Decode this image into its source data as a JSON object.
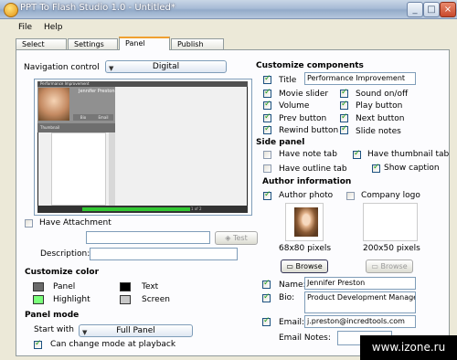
{
  "window": {
    "title": "PPT To Flash Studio 1.0 - Untitled*"
  },
  "caption_buttons": {
    "minimize": "_",
    "maximize": "□",
    "close": "×"
  },
  "menu": {
    "file": "File",
    "help": "Help"
  },
  "tabs": [
    "Select",
    "Settings",
    "Panel",
    "Publish"
  ],
  "left": {
    "nav_label": "Navigation control",
    "nav_value": "Digital",
    "preview": {
      "title": "Performance Improvement",
      "author": "Jennifer Preston",
      "bio_btn": "Bio",
      "email_btn": "Email",
      "thumbnail_label": "Thumbnail",
      "pages": "1 of 2"
    },
    "attachment_label": "Have Attachment",
    "test_label": "Test",
    "description_label": "Description:",
    "customize_color_header": "Customize color",
    "colors": {
      "panel": {
        "label": "Panel",
        "hex": "#6a6a6a"
      },
      "text": {
        "label": "Text",
        "hex": "#000000"
      },
      "highlight": {
        "label": "Highlight",
        "hex": "#7aff7a"
      },
      "screen": {
        "label": "Screen",
        "hex": "#c8c8c8"
      }
    },
    "panel_mode_header": "Panel mode",
    "start_with_label": "Start with",
    "start_with_value": "Full Panel",
    "change_mode_label": "Can change mode at playback"
  },
  "right": {
    "customize_components_header": "Customize components",
    "title_label": "Title",
    "title_value": "Performance Improvement",
    "components": [
      "Movie slider",
      "Sound on/off",
      "Volume",
      "Play button",
      "Prev button",
      "Next button",
      "Rewind button",
      "Slide notes"
    ],
    "side_panel_header": "Side panel",
    "have_note_tab": "Have note tab",
    "have_thumbnail_tab": "Have thumbnail tab",
    "have_outline_tab": "Have outline tab",
    "show_caption": "Show caption",
    "author_info_header": "Author information",
    "author_photo_label": "Author photo",
    "company_logo_label": "Company logo",
    "photo_size": "68x80 pixels",
    "logo_size": "200x50 pixels",
    "browse_label": "Browse",
    "name_label": "Name:",
    "name_value": "Jennifer Preston",
    "bio_label": "Bio:",
    "bio_value": "Product Development Manager",
    "email_label": "Email:",
    "email_value": "j.preston@incredtools.com",
    "email_notes_label": "Email Notes:"
  },
  "watermark": "www.izone.ru"
}
